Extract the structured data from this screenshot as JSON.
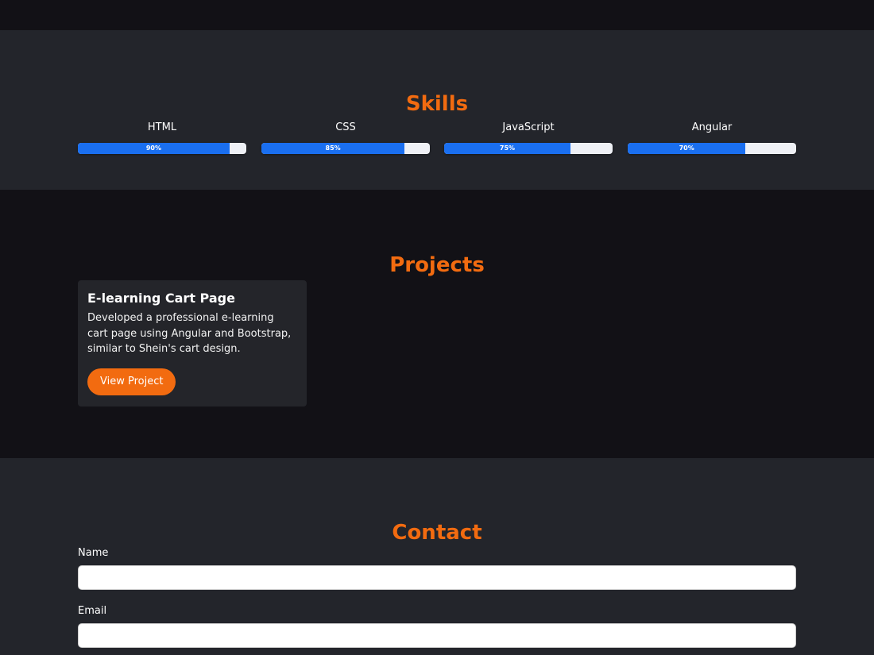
{
  "skills": {
    "title": "Skills",
    "items": [
      {
        "name": "HTML",
        "percent_label": "90%",
        "level": 0.9
      },
      {
        "name": "CSS",
        "percent_label": "85%",
        "level": 0.85
      },
      {
        "name": "JavaScript",
        "percent_label": "75%",
        "level": 0.75
      },
      {
        "name": "Angular",
        "percent_label": "70%",
        "level": 0.7
      }
    ],
    "bar_color": "#1a6ff0"
  },
  "projects": {
    "title": "Projects",
    "items": [
      {
        "title": "E-learning Cart Page",
        "description": "Developed a professional e-learning cart page using Angular and Bootstrap, similar to Shein's cart design.",
        "button_label": "View Project"
      }
    ]
  },
  "contact": {
    "title": "Contact",
    "name_label": "Name",
    "name_value": "",
    "email_label": "Email",
    "email_value": ""
  },
  "colors": {
    "accent": "#f26b10",
    "dark_bg": "#121116",
    "section_bg": "#23252b"
  }
}
